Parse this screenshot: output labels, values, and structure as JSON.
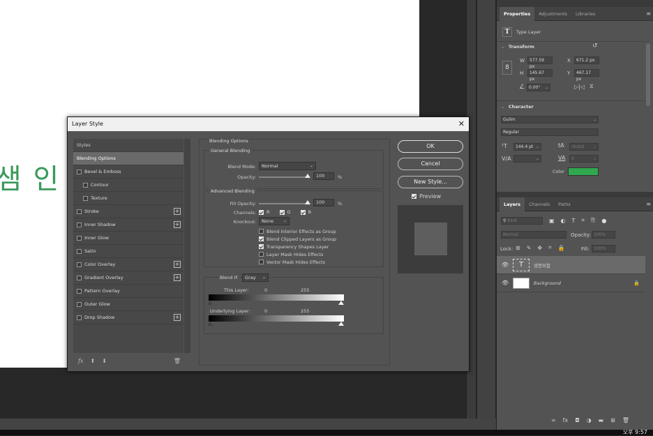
{
  "document": {
    "canvas_text": "샘 인"
  },
  "dialog": {
    "title": "Layer Style",
    "close_glyph": "✕",
    "styles": [
      {
        "label": "Styles",
        "kind": "head",
        "checkbox": false,
        "plus": false
      },
      {
        "label": "Blending Options",
        "kind": "selected",
        "checkbox": false,
        "plus": false
      },
      {
        "label": "Bevel & Emboss",
        "kind": "item",
        "checkbox": true,
        "plus": false
      },
      {
        "label": "Contour",
        "kind": "sub",
        "checkbox": true,
        "plus": false
      },
      {
        "label": "Texture",
        "kind": "sub",
        "checkbox": true,
        "plus": false
      },
      {
        "label": "Stroke",
        "kind": "item",
        "checkbox": true,
        "plus": true
      },
      {
        "label": "Inner Shadow",
        "kind": "item",
        "checkbox": true,
        "plus": true
      },
      {
        "label": "Inner Glow",
        "kind": "item",
        "checkbox": true,
        "plus": false
      },
      {
        "label": "Satin",
        "kind": "item",
        "checkbox": true,
        "plus": false
      },
      {
        "label": "Color Overlay",
        "kind": "item",
        "checkbox": true,
        "plus": true
      },
      {
        "label": "Gradient Overlay",
        "kind": "item",
        "checkbox": true,
        "plus": true
      },
      {
        "label": "Pattern Overlay",
        "kind": "item",
        "checkbox": true,
        "plus": false
      },
      {
        "label": "Outer Glow",
        "kind": "item",
        "checkbox": true,
        "plus": false
      },
      {
        "label": "Drop Shadow",
        "kind": "item",
        "checkbox": true,
        "plus": true
      }
    ],
    "footer": {
      "fx": "fx",
      "up": "⬆",
      "down": "⬇",
      "trash": "🗑"
    },
    "blending": {
      "header": "Blending Options",
      "general_title": "General Blending",
      "blend_mode_label": "Blend Mode:",
      "blend_mode_value": "Normal",
      "opacity_label": "Opacity:",
      "opacity_value": "100",
      "percent": "%",
      "advanced_title": "Advanced Blending",
      "fill_opacity_label": "Fill Opacity:",
      "fill_opacity_value": "100",
      "channels_label": "Channels:",
      "channels": [
        "R",
        "G",
        "B"
      ],
      "knockout_label": "Knockout:",
      "knockout_value": "None",
      "options": [
        {
          "label": "Blend Interior Effects as Group",
          "checked": false
        },
        {
          "label": "Blend Clipped Layers as Group",
          "checked": true
        },
        {
          "label": "Transparency Shapes Layer",
          "checked": true
        },
        {
          "label": "Layer Mask Hides Effects",
          "checked": false
        },
        {
          "label": "Vector Mask Hides Effects",
          "checked": false
        }
      ],
      "blend_if_label": "Blend If:",
      "blend_if_value": "Gray",
      "this_layer_label": "This Layer:",
      "underlying_label": "Underlying Layer:",
      "range_low": "0",
      "range_high": "255"
    },
    "buttons": {
      "ok": "OK",
      "cancel": "Cancel",
      "new_style": "New Style..."
    },
    "preview_label": "Preview"
  },
  "properties": {
    "tabs": [
      "Properties",
      "Adjustments",
      "Libraries"
    ],
    "menu_glyph": "≡",
    "layer_type": "Type Layer",
    "transform_title": "Transform",
    "w_label": "W",
    "w_value": "577.59 px",
    "h_label": "H",
    "h_value": "145.67 px",
    "x_label": "X",
    "x_value": "671.2 px",
    "y_label": "Y",
    "y_value": "467.17 px",
    "angle_value": "0.00°",
    "character_title": "Character",
    "font_family": "Gulim",
    "font_style": "Regular",
    "font_size": "144.4 pt",
    "leading": "(Auto)",
    "tracking": "0",
    "color_label": "Color",
    "color_hex": "#2fa84f"
  },
  "layers": {
    "tabs": [
      "Layers",
      "Channels",
      "Paths"
    ],
    "kind_placeholder": "Kind",
    "mode": "Normal",
    "opacity_label": "Opacity:",
    "opacity_value": "100%",
    "lock_label": "Lock:",
    "fill_label": "Fill:",
    "fill_value": "100%",
    "items": [
      {
        "name": "샘앤쉬함",
        "type": "text",
        "selected": true
      },
      {
        "name": "Background",
        "type": "pixel",
        "selected": false
      }
    ]
  },
  "taskbar": {
    "clock": "오후 9:57"
  }
}
